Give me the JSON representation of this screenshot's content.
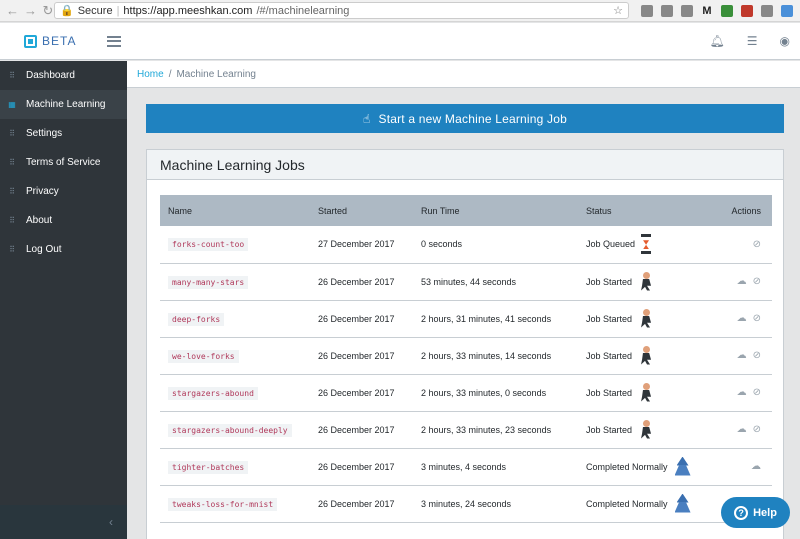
{
  "browser": {
    "secure_label": "Secure",
    "url_main": "https://app.meeshkan.com",
    "url_rest": "/#/machinelearning"
  },
  "header": {
    "brand": "BETA"
  },
  "sidebar": {
    "items": [
      {
        "label": "Dashboard"
      },
      {
        "label": "Machine Learning"
      },
      {
        "label": "Settings"
      },
      {
        "label": "Terms of Service"
      },
      {
        "label": "Privacy"
      },
      {
        "label": "About"
      },
      {
        "label": "Log Out"
      }
    ]
  },
  "breadcrumb": {
    "home": "Home",
    "current": "Machine Learning"
  },
  "main": {
    "start_button": "Start a new Machine Learning Job",
    "card_title": "Machine Learning Jobs",
    "columns": [
      "Name",
      "Started",
      "Run Time",
      "Status",
      "Actions"
    ],
    "rows": [
      {
        "name": "forks-count-too",
        "started": "27 December 2017",
        "runtime": "0 seconds",
        "status": "Job Queued",
        "icon": "hourglass"
      },
      {
        "name": "many-many-stars",
        "started": "26 December 2017",
        "runtime": "53 minutes, 44 seconds",
        "status": "Job Started",
        "icon": "runner"
      },
      {
        "name": "deep-forks",
        "started": "26 December 2017",
        "runtime": "2 hours, 31 minutes, 41 seconds",
        "status": "Job Started",
        "icon": "runner"
      },
      {
        "name": "we-love-forks",
        "started": "26 December 2017",
        "runtime": "2 hours, 33 minutes, 14 seconds",
        "status": "Job Started",
        "icon": "runner"
      },
      {
        "name": "stargazers-abound",
        "started": "26 December 2017",
        "runtime": "2 hours, 33 minutes, 0 seconds",
        "status": "Job Started",
        "icon": "runner"
      },
      {
        "name": "stargazers-abound-deeply",
        "started": "26 December 2017",
        "runtime": "2 hours, 33 minutes, 23 seconds",
        "status": "Job Started",
        "icon": "runner"
      },
      {
        "name": "tighter-batches",
        "started": "26 December 2017",
        "runtime": "3 minutes, 4 seconds",
        "status": "Completed Normally",
        "icon": "wizard"
      },
      {
        "name": "tweaks-loss-for-mnist",
        "started": "26 December 2017",
        "runtime": "3 minutes, 24 seconds",
        "status": "Completed Normally",
        "icon": "wizard"
      }
    ]
  },
  "help": {
    "label": "Help"
  }
}
